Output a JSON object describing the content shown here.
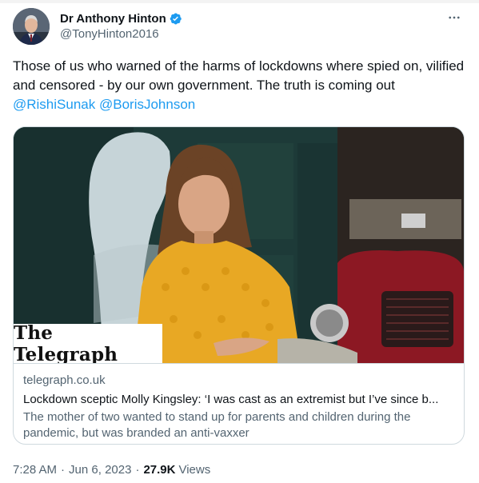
{
  "author": {
    "display_name": "Dr Anthony Hinton",
    "handle": "@TonyHinton2016",
    "verified": true,
    "avatar_icon": "profile-photo"
  },
  "tweet": {
    "text": "Those of us who warned of the harms of lockdowns where spied on, vilified and censored - by our own government. The truth is coming out",
    "mentions": [
      "@RishiSunak",
      "@BorisJohnson"
    ]
  },
  "card": {
    "source_logo": "The Telegraph",
    "domain": "telegraph.co.uk",
    "title": "Lockdown sceptic Molly Kingsley: ‘I was cast as an extremist but I’ve since b...",
    "description": "The mother of two wanted to stand up for parents and children during the pandemic, but was branded an anti-vaxxer"
  },
  "meta": {
    "time": "7:28 AM",
    "date": "Jun 6, 2023",
    "views_count": "27.9K",
    "views_label": "Views",
    "separator": "·"
  },
  "colors": {
    "accent": "#1d9bf0",
    "text_primary": "#0f1419",
    "text_secondary": "#536471",
    "border": "#cfd9de"
  }
}
